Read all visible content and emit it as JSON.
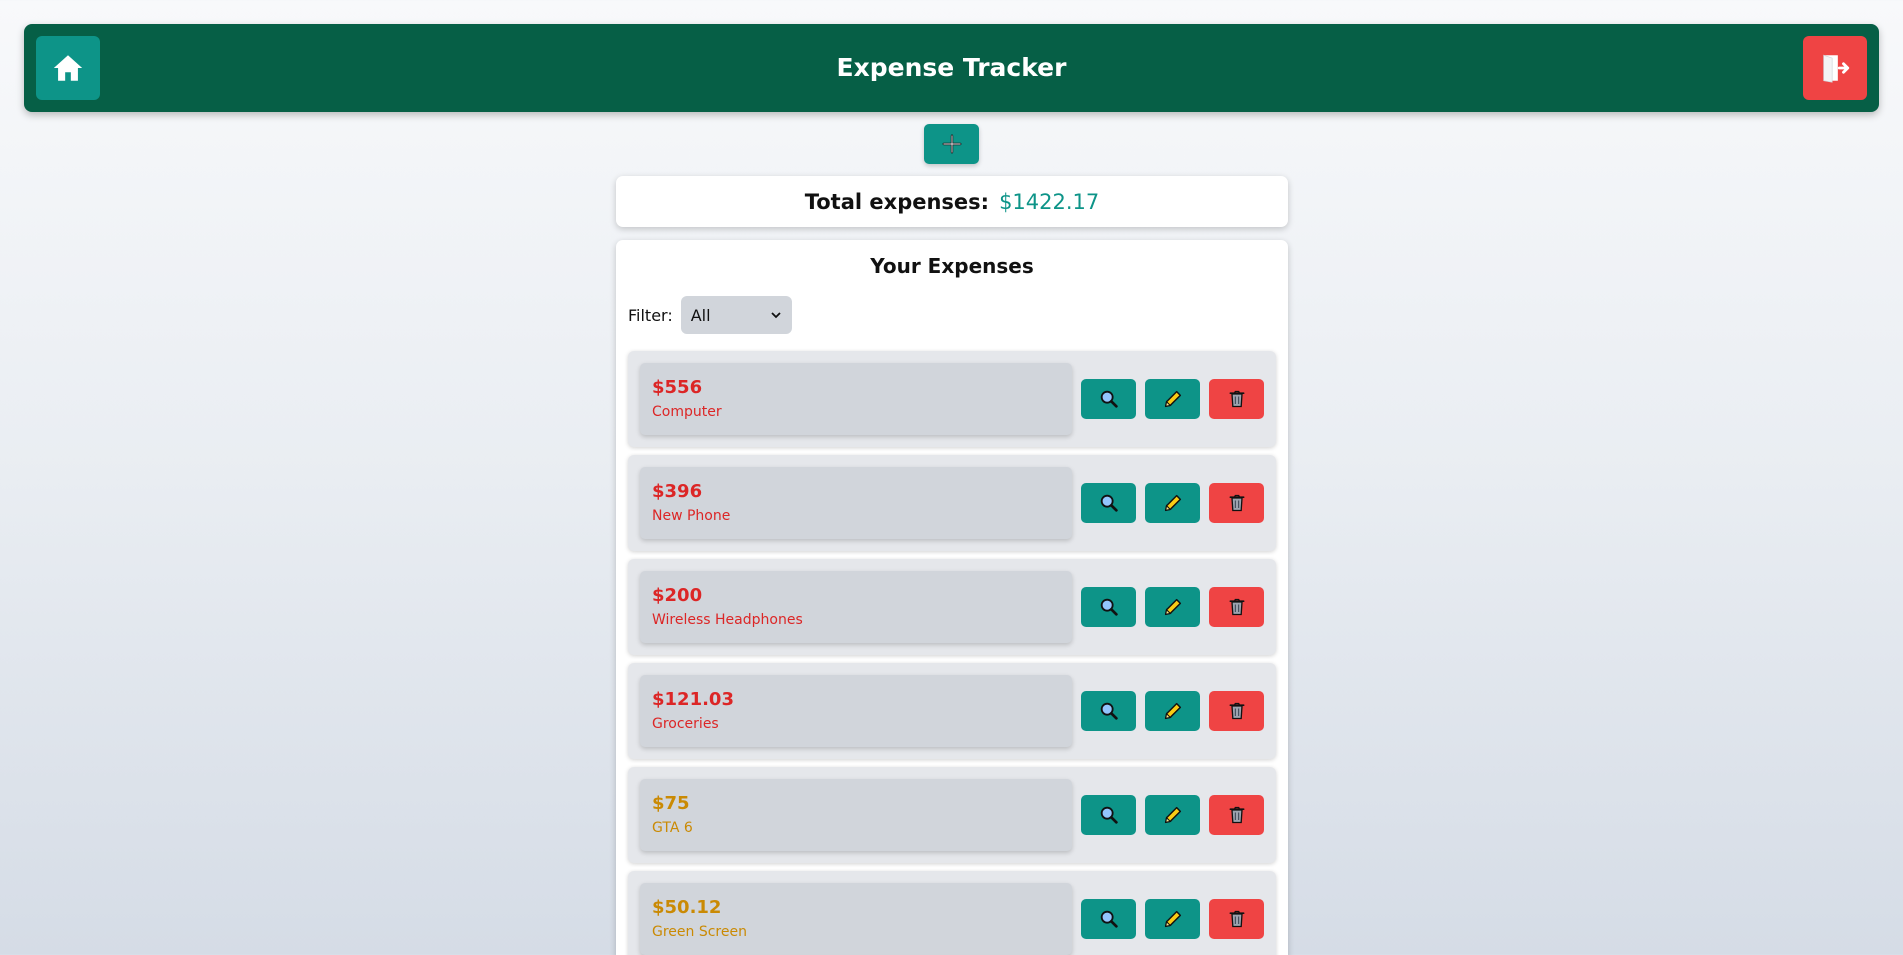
{
  "header": {
    "title": "Expense Tracker",
    "home_icon": "home-icon",
    "logout_icon": "logout-icon"
  },
  "add_button": {
    "icon": "plus-icon"
  },
  "total": {
    "label": "Total expenses:",
    "value": "$1422.17"
  },
  "list": {
    "title": "Your Expenses",
    "filter_label": "Filter:",
    "filter_value": "All",
    "items": [
      {
        "amount": "$556",
        "name": "Computer",
        "tone": "red"
      },
      {
        "amount": "$396",
        "name": "New Phone",
        "tone": "red"
      },
      {
        "amount": "$200",
        "name": "Wireless Headphones",
        "tone": "red"
      },
      {
        "amount": "$121.03",
        "name": "Groceries",
        "tone": "red"
      },
      {
        "amount": "$75",
        "name": "GTA 6",
        "tone": "amber"
      },
      {
        "amount": "$50.12",
        "name": "Green Screen",
        "tone": "amber"
      }
    ]
  },
  "colors": {
    "header": "#065f46",
    "accent": "#0d9488",
    "danger": "#ef4444",
    "high_expense": "#dc2626",
    "mid_expense": "#ca8a04"
  }
}
